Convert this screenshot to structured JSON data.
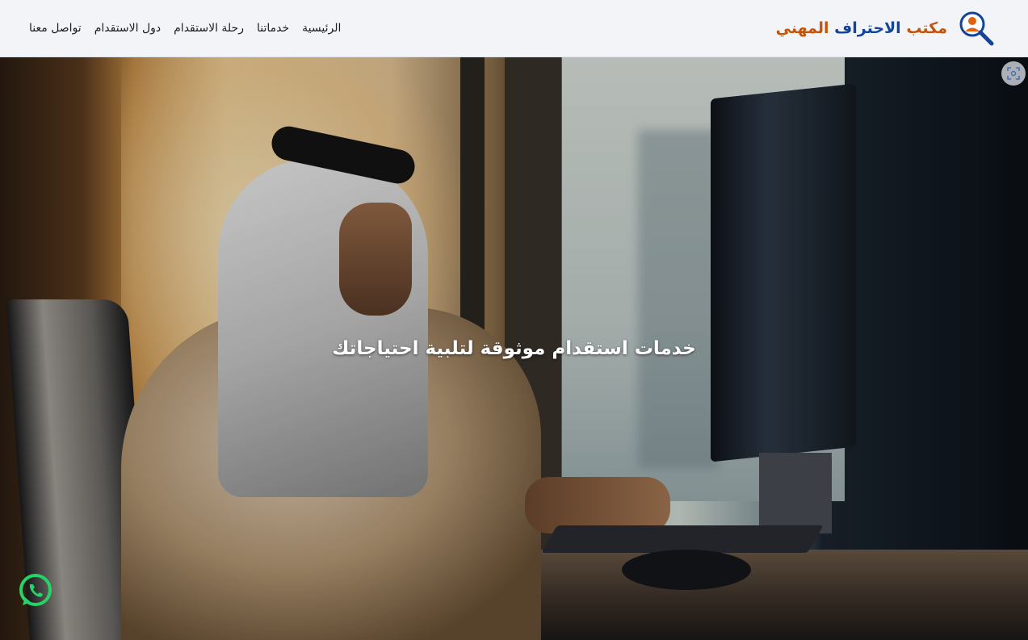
{
  "header": {
    "brand": {
      "word1": "مكتب",
      "word2": "الاحتراف",
      "word3": "المهني"
    },
    "nav": [
      {
        "label": "الرئيسية"
      },
      {
        "label": "خدماتنا"
      },
      {
        "label": "رحلة الاستقدام"
      },
      {
        "label": "دول الاستقدام"
      },
      {
        "label": "تواصل معنا"
      }
    ]
  },
  "hero": {
    "title": "خدمات استقدام موثوقة لتلبية احتياجاتك"
  },
  "icons": {
    "logo": "magnifier-person-icon",
    "fullscreen": "fullscreen-icon",
    "whatsapp": "whatsapp-icon"
  },
  "colors": {
    "brand_orange": "#c2550b",
    "brand_blue": "#11449a",
    "header_bg": "#f2f4f8",
    "whatsapp_green": "#25d366"
  }
}
